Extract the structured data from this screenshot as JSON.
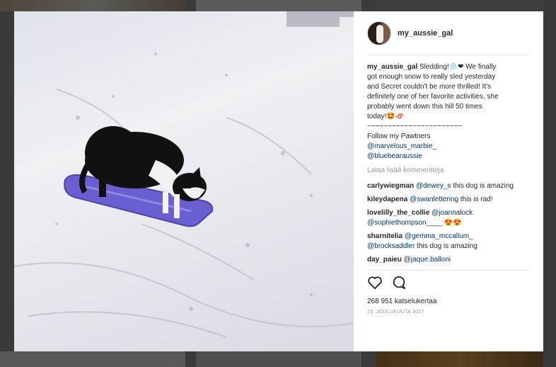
{
  "post": {
    "username": "my_aussie_gal",
    "caption_lines": [
      "Sledding!❄️❤ We finally",
      "got enough snow to really sled yesterday",
      "and Secret couldn't be more thrilled! It's",
      "definitely one of her favorite activities, she",
      "probably went down this hill 50 times",
      "today!🤩🛷"
    ],
    "separator": "~~~~~~~~~~~~~~~~~~~~~~~",
    "follow_text": "Follow my Pawtners",
    "follow_mentions": [
      "@marvelous_marbie_",
      "@bluebearaussie"
    ],
    "load_more": "Lataa lisää kommentteja",
    "comments": [
      {
        "user": "carlywiegman",
        "mention": "@dewey_s",
        "text": " this dog is amazing",
        "suffix": ""
      },
      {
        "user": "kileydapena",
        "mention": "@swanlettering",
        "text": " this is rad!",
        "suffix": ""
      },
      {
        "user": "lovelilly_the_collie",
        "mention": "@joannalock",
        "mention2": "@sophiethompson____",
        "text": " 😍😍"
      },
      {
        "user": "sharnitelia",
        "mention": "@gemma_mccallum_",
        "mention2": "@brocksaddler",
        "text": " this dog is amazing"
      },
      {
        "user": "day_paieu",
        "mention": "@jaque.balloni",
        "text": ""
      }
    ],
    "views": "268 951 katselukertaa",
    "date": "29. JOULUKUUTA 2017"
  },
  "icons": {
    "like": "heart-icon",
    "comment": "comment-bubble-icon"
  }
}
